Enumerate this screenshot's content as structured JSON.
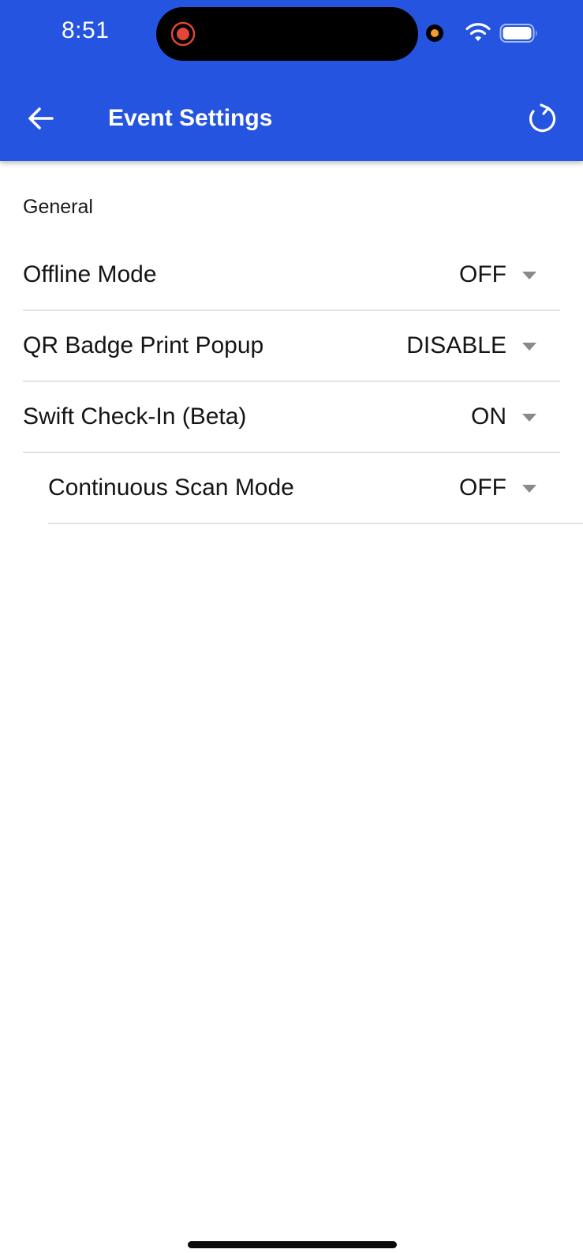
{
  "status_bar": {
    "time": "8:51"
  },
  "app_bar": {
    "title": "Event Settings",
    "back_icon": "arrow-left-icon",
    "refresh_icon": "refresh-icon"
  },
  "colors": {
    "header_bg": "#2454e0",
    "divider": "#e2e2e2",
    "dropdown_arrow": "#8a8a8a"
  },
  "section": {
    "title": "General"
  },
  "settings": [
    {
      "label": "Offline Mode",
      "value": "OFF"
    },
    {
      "label": "QR Badge Print Popup",
      "value": "DISABLE"
    },
    {
      "label": "Swift Check-In (Beta)",
      "value": "ON"
    },
    {
      "label": "Continuous Scan Mode",
      "value": "OFF"
    }
  ]
}
